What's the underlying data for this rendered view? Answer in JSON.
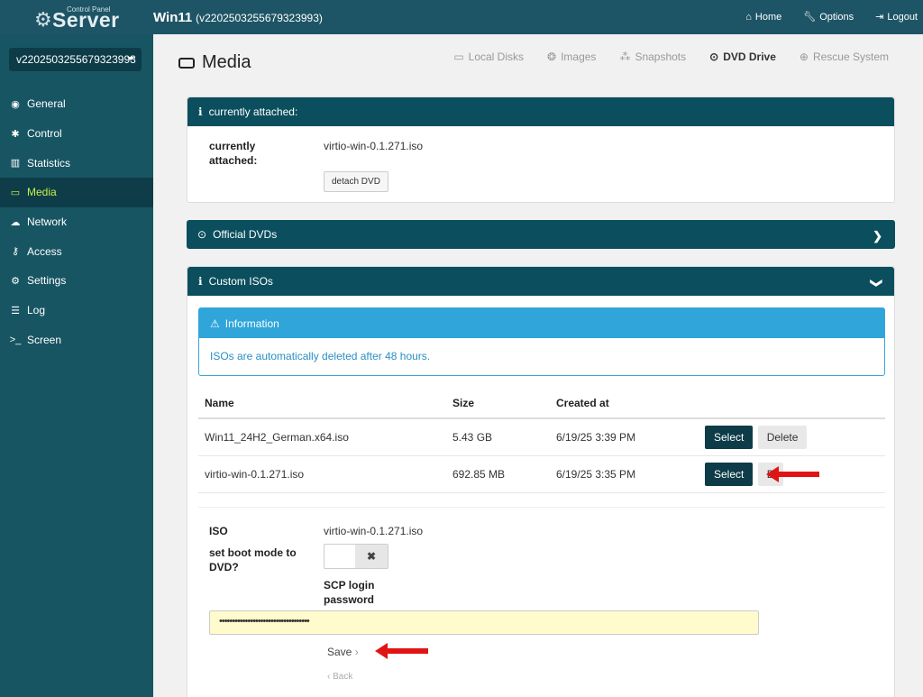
{
  "header": {
    "logo_small": "Control Panel",
    "logo_big": "Server",
    "title": "Win11",
    "subtitle": "(v2202503255679323993)",
    "nav": [
      {
        "icon": "home-icon",
        "label": "Home"
      },
      {
        "icon": "wrench-icon",
        "label": "Options"
      },
      {
        "icon": "logout-icon",
        "label": "Logout"
      }
    ]
  },
  "sidebar": {
    "server_select": "v2202503255679323993",
    "items": [
      {
        "icon": "eye-icon",
        "glyph": "◉",
        "label": "General"
      },
      {
        "icon": "gear-icon",
        "glyph": "✱",
        "label": "Control"
      },
      {
        "icon": "chart-icon",
        "glyph": "▥",
        "label": "Statistics"
      },
      {
        "icon": "disk-icon",
        "glyph": "▭",
        "label": "Media"
      },
      {
        "icon": "cloud-icon",
        "glyph": "☁",
        "label": "Network"
      },
      {
        "icon": "key-icon",
        "glyph": "⚷",
        "label": "Access"
      },
      {
        "icon": "cogs-icon",
        "glyph": "⚙",
        "label": "Settings"
      },
      {
        "icon": "list-icon",
        "glyph": "☰",
        "label": "Log"
      },
      {
        "icon": "terminal-icon",
        "glyph": ">_",
        "label": "Screen"
      }
    ],
    "active_index": 3
  },
  "page": {
    "title": "Media",
    "tabs": [
      {
        "icon": "disk-icon",
        "glyph": "▭",
        "label": "Local Disks"
      },
      {
        "icon": "images-icon",
        "glyph": "❂",
        "label": "Images"
      },
      {
        "icon": "snapshots-icon",
        "glyph": "⁂",
        "label": "Snapshots"
      },
      {
        "icon": "dvd-icon",
        "glyph": "⊙",
        "label": "DVD Drive"
      },
      {
        "icon": "lifebuoy-icon",
        "glyph": "⊕",
        "label": "Rescue System"
      }
    ],
    "active_tab": 3
  },
  "attached": {
    "header": "currently attached:",
    "label": "currently attached:",
    "value": "virtio-win-0.1.271.iso",
    "detach_label": "detach DVD"
  },
  "official": {
    "header": "Official DVDs"
  },
  "custom": {
    "header": "Custom ISOs",
    "info_title": "Information",
    "info_text": "ISOs are automatically deleted after 48 hours.",
    "columns": [
      "Name",
      "Size",
      "Created at"
    ],
    "rows": [
      {
        "name": "Win11_24H2_German.x64.iso",
        "size": "5.43 GB",
        "created": "6/19/25 3:39 PM",
        "select": "Select",
        "delete": "Delete"
      },
      {
        "name": "virtio-win-0.1.271.iso",
        "size": "692.85 MB",
        "created": "6/19/25 3:35 PM",
        "select": "Select",
        "delete": "D"
      }
    ],
    "form": {
      "iso_label": "ISO",
      "iso_value": "virtio-win-0.1.271.iso",
      "boot_label": "set boot mode to DVD?",
      "toggle_off_glyph": "✖",
      "scp_label": "SCP login password",
      "password_mask": "•••••••••••••••••••••••••••••••••••",
      "save_label": "Save",
      "back_label": "Back"
    }
  },
  "colors": {
    "topbar": "#1e5566",
    "sidebar": "#185563",
    "sidebar_active": "#0e3d49",
    "active_text": "#c6f14a",
    "panel_head": "#0b4e5e",
    "info": "#2fa5d9",
    "arrow": "#e01414"
  }
}
